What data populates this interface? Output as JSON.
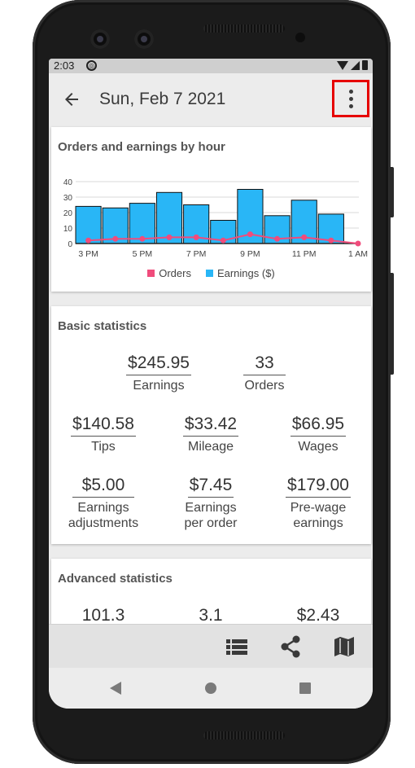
{
  "status": {
    "time": "2:03",
    "app_badge": "◎"
  },
  "appbar": {
    "title": "Sun, Feb 7 2021"
  },
  "chart_card": {
    "title": "Orders and earnings by hour",
    "legend_orders": "Orders",
    "legend_earnings": "Earnings ($)"
  },
  "chart_data": {
    "type": "bar",
    "y_ticks": [
      "0",
      "10",
      "20",
      "30",
      "40"
    ],
    "x_tick_labels": [
      "3 PM",
      "5 PM",
      "7 PM",
      "9 PM",
      "11 PM",
      "1 AM"
    ],
    "ylim": [
      0,
      40
    ],
    "grid": true,
    "legend_position": "bottom",
    "series": [
      {
        "name": "Earnings ($)",
        "kind": "bar",
        "color": "#29b6f6",
        "values": [
          24,
          23,
          26,
          33,
          25,
          15,
          35,
          18,
          28,
          19
        ]
      },
      {
        "name": "Orders",
        "kind": "line",
        "color": "#f04c7c",
        "values": [
          2,
          3,
          3,
          4,
          4,
          2,
          6,
          3,
          4,
          2,
          0
        ]
      }
    ]
  },
  "basic": {
    "title": "Basic statistics",
    "earnings_value": "$245.95",
    "earnings_label": "Earnings",
    "orders_value": "33",
    "orders_label": "Orders",
    "tips_value": "$140.58",
    "tips_label": "Tips",
    "mileage_value": "$33.42",
    "mileage_label": "Mileage",
    "wages_value": "$66.95",
    "wages_label": "Wages",
    "adjustments_value": "$5.00",
    "adjustments_label_1": "Earnings",
    "adjustments_label_2": "adjustments",
    "per_order_value": "$7.45",
    "per_order_label_1": "Earnings",
    "per_order_label_2": "per order",
    "prewage_value": "$179.00",
    "prewage_label_1": "Pre-wage",
    "prewage_label_2": "earnings"
  },
  "advanced": {
    "title": "Advanced statistics",
    "value_1": "101.3",
    "value_2": "3.1",
    "value_3": "$2.43"
  },
  "bottombar": {
    "icons": [
      "list-icon",
      "share-icon",
      "map-icon"
    ]
  },
  "navbar": {
    "icons": [
      "nav-back-icon",
      "nav-home-icon",
      "nav-recents-icon"
    ]
  }
}
